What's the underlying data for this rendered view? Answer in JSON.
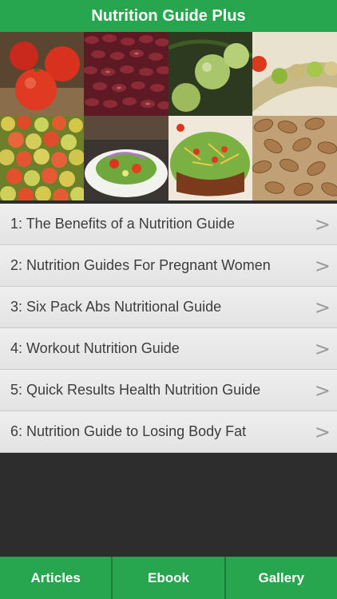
{
  "app": {
    "title": "Nutrition Guide Plus"
  },
  "gallery": {
    "tiles": [
      {
        "name": "tomatoes-photo"
      },
      {
        "name": "kidney-beans-photo"
      },
      {
        "name": "green-tomatoes-photo"
      },
      {
        "name": "pea-pod-photo"
      },
      {
        "name": "apples-photo"
      },
      {
        "name": "salad-plate-photo"
      },
      {
        "name": "taco-salad-photo"
      },
      {
        "name": "almonds-photo"
      }
    ]
  },
  "articles": [
    {
      "label": "1: The Benefits of a Nutrition Guide",
      "chevron": ">"
    },
    {
      "label": "2: Nutrition Guides For Pregnant Women",
      "chevron": ">"
    },
    {
      "label": "3: Six Pack Abs Nutritional Guide",
      "chevron": ">"
    },
    {
      "label": "4: Workout Nutrition Guide",
      "chevron": ">"
    },
    {
      "label": "5: Quick Results Health Nutrition Guide",
      "chevron": ">"
    },
    {
      "label": "6: Nutrition Guide to Losing Body Fat",
      "chevron": ">"
    }
  ],
  "tabs": [
    {
      "label": "Articles"
    },
    {
      "label": "Ebook"
    },
    {
      "label": "Gallery"
    }
  ],
  "colors": {
    "accent": "#27a54f",
    "list_bg": "#e6e6e6",
    "page_bg": "#2d2d2d"
  }
}
